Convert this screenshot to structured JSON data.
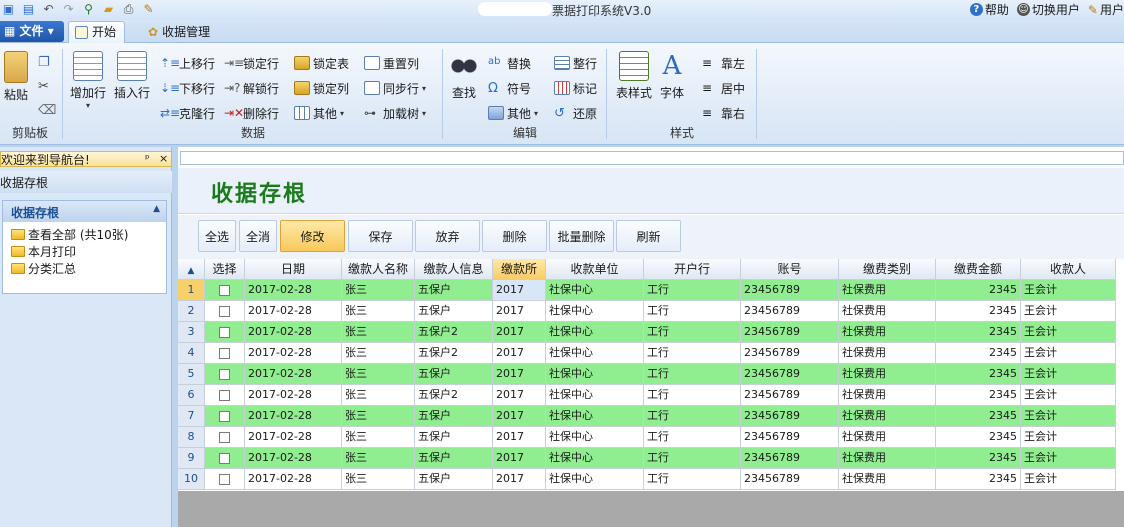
{
  "titlebar": {
    "title": "票据打印系统V3.0",
    "help": "帮助",
    "switch_user": "切换用户",
    "user": "用户"
  },
  "tabs": {
    "file": "文件",
    "start": "开始",
    "receipt_mgmt": "收据管理"
  },
  "ribbon": {
    "clipboard": {
      "label": "剪贴板",
      "paste": "粘贴"
    },
    "data": {
      "label": "数据",
      "add_row": "增加行",
      "insert_row": "插入行",
      "move_up": "上移行",
      "move_down": "下移行",
      "clone_row": "克隆行",
      "lock_row": "锁定行",
      "unlock_row": "解锁行",
      "delete_row": "删除行",
      "lock_table": "锁定表",
      "lock_col": "锁定列",
      "other": "其他",
      "reset_col": "重置列",
      "sync_row": "同步行",
      "load_tree": "加载树"
    },
    "edit": {
      "label": "编辑",
      "find": "查找",
      "replace": "替换",
      "symbol": "符号",
      "other": "其他",
      "arrange_row": "整行",
      "mark": "标记",
      "restore": "还原"
    },
    "style": {
      "label": "样式",
      "table_style": "表样式",
      "font": "字体",
      "align_left": "靠左",
      "align_center": "居中",
      "align_right": "靠右"
    }
  },
  "nav": {
    "welcome": "欢迎来到导航台!",
    "pin": "ᵖ",
    "close": "×",
    "section": "收据存根",
    "panel_title": "收据存根",
    "items": [
      "查看全部 (共10张)",
      "本月打印",
      "分类汇总"
    ]
  },
  "main": {
    "page_title": "收据存根",
    "toolbar": [
      "全选",
      "全消",
      "修改",
      "保存",
      "放弃",
      "删除",
      "批量删除",
      "刷新"
    ],
    "columns": [
      "选择",
      "日期",
      "缴款人名称",
      "缴款人信息",
      "缴款所",
      "收款单位",
      "开户行",
      "账号",
      "缴费类别",
      "缴费金额",
      "收款人"
    ],
    "rows": [
      {
        "no": "1",
        "date": "2017-02-28",
        "name": "张三",
        "info": "五保户",
        "office": "2017",
        "unit": "社保中心",
        "bank": "工行",
        "account": "23456789",
        "category": "社保费用",
        "amount": "2345",
        "payee": "王会计"
      },
      {
        "no": "2",
        "date": "2017-02-28",
        "name": "张三",
        "info": "五保户",
        "office": "2017",
        "unit": "社保中心",
        "bank": "工行",
        "account": "23456789",
        "category": "社保费用",
        "amount": "2345",
        "payee": "王会计"
      },
      {
        "no": "3",
        "date": "2017-02-28",
        "name": "张三",
        "info": "五保户2",
        "office": "2017",
        "unit": "社保中心",
        "bank": "工行",
        "account": "23456789",
        "category": "社保费用",
        "amount": "2345",
        "payee": "王会计"
      },
      {
        "no": "4",
        "date": "2017-02-28",
        "name": "张三",
        "info": "五保户2",
        "office": "2017",
        "unit": "社保中心",
        "bank": "工行",
        "account": "23456789",
        "category": "社保费用",
        "amount": "2345",
        "payee": "王会计"
      },
      {
        "no": "5",
        "date": "2017-02-28",
        "name": "张三",
        "info": "五保户",
        "office": "2017",
        "unit": "社保中心",
        "bank": "工行",
        "account": "23456789",
        "category": "社保费用",
        "amount": "2345",
        "payee": "王会计"
      },
      {
        "no": "6",
        "date": "2017-02-28",
        "name": "张三",
        "info": "五保户2",
        "office": "2017",
        "unit": "社保中心",
        "bank": "工行",
        "account": "23456789",
        "category": "社保费用",
        "amount": "2345",
        "payee": "王会计"
      },
      {
        "no": "7",
        "date": "2017-02-28",
        "name": "张三",
        "info": "五保户",
        "office": "2017",
        "unit": "社保中心",
        "bank": "工行",
        "account": "23456789",
        "category": "社保费用",
        "amount": "2345",
        "payee": "王会计"
      },
      {
        "no": "8",
        "date": "2017-02-28",
        "name": "张三",
        "info": "五保户",
        "office": "2017",
        "unit": "社保中心",
        "bank": "工行",
        "account": "23456789",
        "category": "社保费用",
        "amount": "2345",
        "payee": "王会计"
      },
      {
        "no": "9",
        "date": "2017-02-28",
        "name": "张三",
        "info": "五保户",
        "office": "2017",
        "unit": "社保中心",
        "bank": "工行",
        "account": "23456789",
        "category": "社保费用",
        "amount": "2345",
        "payee": "王会计"
      },
      {
        "no": "10",
        "date": "2017-02-28",
        "name": "张三",
        "info": "五保户",
        "office": "2017",
        "unit": "社保中心",
        "bank": "工行",
        "account": "23456789",
        "category": "社保费用",
        "amount": "2345",
        "payee": "王会计"
      }
    ]
  },
  "colors": {
    "highlight_row": "#90ee90",
    "title_green": "#1b7a1b",
    "active_button": "#f8c95a"
  }
}
